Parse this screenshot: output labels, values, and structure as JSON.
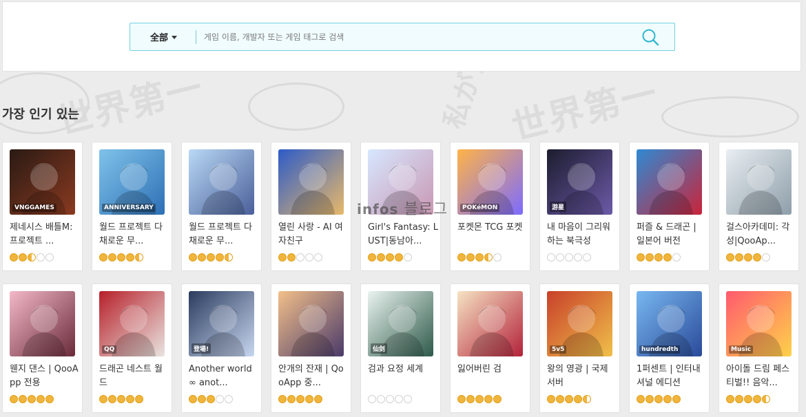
{
  "search": {
    "category_label": "全部",
    "placeholder": "게임 이름, 개발자 또는 게임 태그로 검색"
  },
  "section": {
    "title": "가장 인기 있는"
  },
  "watermark": {
    "part1": "infos",
    "part2": "블로그"
  },
  "background": {
    "kanji_1": "世界第一",
    "kanji_2": "私がカ",
    "kanji_3": "世界第一"
  },
  "games": [
    {
      "name": "제네시스 배틀M: 프로젝트 ...",
      "rating": 2.5,
      "icon": "dark-hair-warrior-portrait",
      "colors": [
        "#2a1a14",
        "#8a3a20"
      ],
      "badge": "VNGGAMES"
    },
    {
      "name": "월드 프로젝트 다채로운 무...",
      "rating": 4.5,
      "icon": "miku-anniversary-art",
      "colors": [
        "#7fc3ea",
        "#2d6fb5"
      ],
      "badge": "ANNIVERSARY"
    },
    {
      "name": "월드 프로젝트 다채로운 무...",
      "rating": 4.5,
      "icon": "miku-duo-art",
      "colors": [
        "#b9d9f5",
        "#4a5f9a"
      ],
      "badge": ""
    },
    {
      "name": "열린 사랑 - AI 여자친구",
      "rating": 2,
      "icon": "cat-ear-girl-art",
      "colors": [
        "#2c5bc8",
        "#e8b96a"
      ],
      "badge": ""
    },
    {
      "name": "Girl's Fantasy: LUST|동남아...",
      "rating": 4,
      "icon": "white-hair-girl-art",
      "colors": [
        "#d7e7ff",
        "#c997b3"
      ],
      "badge": ""
    },
    {
      "name": "포켓몬 TCG 포켓",
      "rating": 3.5,
      "icon": "pokemon-card-icon",
      "colors": [
        "#ffb347",
        "#7c6bff"
      ],
      "badge": "POKéMON"
    },
    {
      "name": "내 마음이 그리워하는 북극성",
      "rating": 0,
      "icon": "dark-hair-girl-art",
      "colors": [
        "#1c1c2e",
        "#6c5aa8"
      ],
      "badge": "游星"
    },
    {
      "name": "퍼즐 & 드래곤 | 일본어 버전",
      "rating": 4,
      "icon": "red-dragon-art",
      "colors": [
        "#2f8ad3",
        "#c9243a"
      ],
      "badge": ""
    },
    {
      "name": "걸스아카데미: 각성|QooAp...",
      "rating": 4,
      "icon": "horned-girl-art",
      "colors": [
        "#e9eef2",
        "#8e9ea9"
      ],
      "badge": ""
    },
    {
      "name": "웬지 댄스 | QooApp 전용",
      "rating": 5,
      "icon": "pink-kimono-girl-art",
      "colors": [
        "#f3b9c8",
        "#6a2a3a"
      ],
      "badge": ""
    },
    {
      "name": "드래곤 네스트 월드",
      "rating": 5,
      "icon": "red-hood-girl-art",
      "colors": [
        "#b7202a",
        "#e9e4e0"
      ],
      "badge": "QQ"
    },
    {
      "name": "Another world∞ anot...",
      "rating": 3,
      "icon": "swordsman-art",
      "colors": [
        "#2b3b5e",
        "#c7d7f0"
      ],
      "badge": "登場!"
    },
    {
      "name": "안개의 잔재 | QooApp 중...",
      "rating": 5,
      "icon": "blonde-girl-art",
      "colors": [
        "#f3c08a",
        "#4a3a6a"
      ],
      "badge": ""
    },
    {
      "name": "검과 요정 세계",
      "rating": 0,
      "icon": "calligraphy-sword-icon",
      "colors": [
        "#eaf3ef",
        "#2d5a4a"
      ],
      "badge": "仙剑"
    },
    {
      "name": "잃어버린 검",
      "rating": 5,
      "icon": "blonde-knight-girl-art",
      "colors": [
        "#f6e3c3",
        "#b3223a"
      ],
      "badge": ""
    },
    {
      "name": "왕의 영광 | 국제 서버",
      "rating": 4.5,
      "icon": "warrior-hero-art",
      "colors": [
        "#c8402a",
        "#f0c04a"
      ],
      "badge": "5v5"
    },
    {
      "name": "1퍼센트 | 인터내셔널 에디션",
      "rating": 5,
      "icon": "blue-anime-girl-art",
      "colors": [
        "#78b8f0",
        "#2a4a9a"
      ],
      "badge": "hundredth"
    },
    {
      "name": "아이돌 드림 페스티벌!! 음악...",
      "rating": 4.5,
      "icon": "red-hair-idol-art",
      "colors": [
        "#ff5a6e",
        "#ffd24a"
      ],
      "badge": "Music"
    }
  ]
}
